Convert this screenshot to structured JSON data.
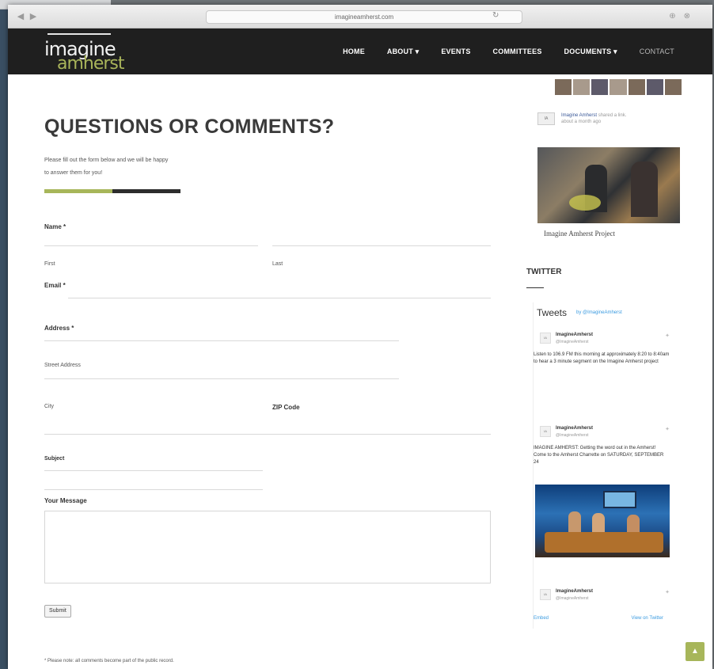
{
  "browser": {
    "url": "imagineamherst.com",
    "back_icon": "back-icon",
    "reload_icon": "reload-icon"
  },
  "site": {
    "logo_word1": "imagine",
    "logo_word2": "amherst",
    "menu": [
      "HOME",
      "ABOUT ▾",
      "EVENTS",
      "COMMITTEES",
      "DOCUMENTS ▾",
      "CONTACT"
    ]
  },
  "main": {
    "title": "QUESTIONS OR COMMENTS?",
    "intro_line1": "Please fill out the form below and we will be happy",
    "intro_line2": "to answer them for you!",
    "name_label": "Name *",
    "first_label": "First",
    "last_label": "Last",
    "email_label": "Email *",
    "address_label": "Address *",
    "street_label": "Street Address",
    "city_label": "City",
    "zip_label": "ZIP Code",
    "subject_label": "Subject",
    "message_label": "Your Message",
    "submit_label": "Submit",
    "footnote": "* Please note: all comments become part of the public record."
  },
  "sidebar": {
    "fb_post_author": "Imagine Amherst",
    "fb_post_meta": "shared a link.",
    "fb_post_time": "about a month ago",
    "photo_caption": "Imagine Amherst Project",
    "twitter_heading": "TWITTER",
    "tweets_title": "Tweets",
    "tweets_by": "by @ImagineAmherst",
    "tweets": [
      {
        "name": "ImagineAmherst",
        "handle": "@ImagineAmherst",
        "text": "Listen to 106.9 FM this morning at approximately 8:20 to 8:40am to hear a 3 minute segment on the Imagine Amherst project"
      },
      {
        "name": "ImagineAmherst",
        "handle": "@ImagineAmherst",
        "text": "IMAGINE AMHERST: Getting the word out in the Amherst! Come to the Amherst Charrette on SATURDAY, SEPTEMBER 24"
      },
      {
        "name": "ImagineAmherst",
        "handle": "@ImagineAmherst",
        "text": ""
      }
    ],
    "embed_label": "Embed",
    "view_on_twitter": "View on Twitter"
  },
  "icons": {
    "to_top": "chevron-up-icon"
  },
  "colors": {
    "accent": "#a7b65a",
    "header_bg": "#1f1f1f",
    "link": "#3b9be0"
  }
}
